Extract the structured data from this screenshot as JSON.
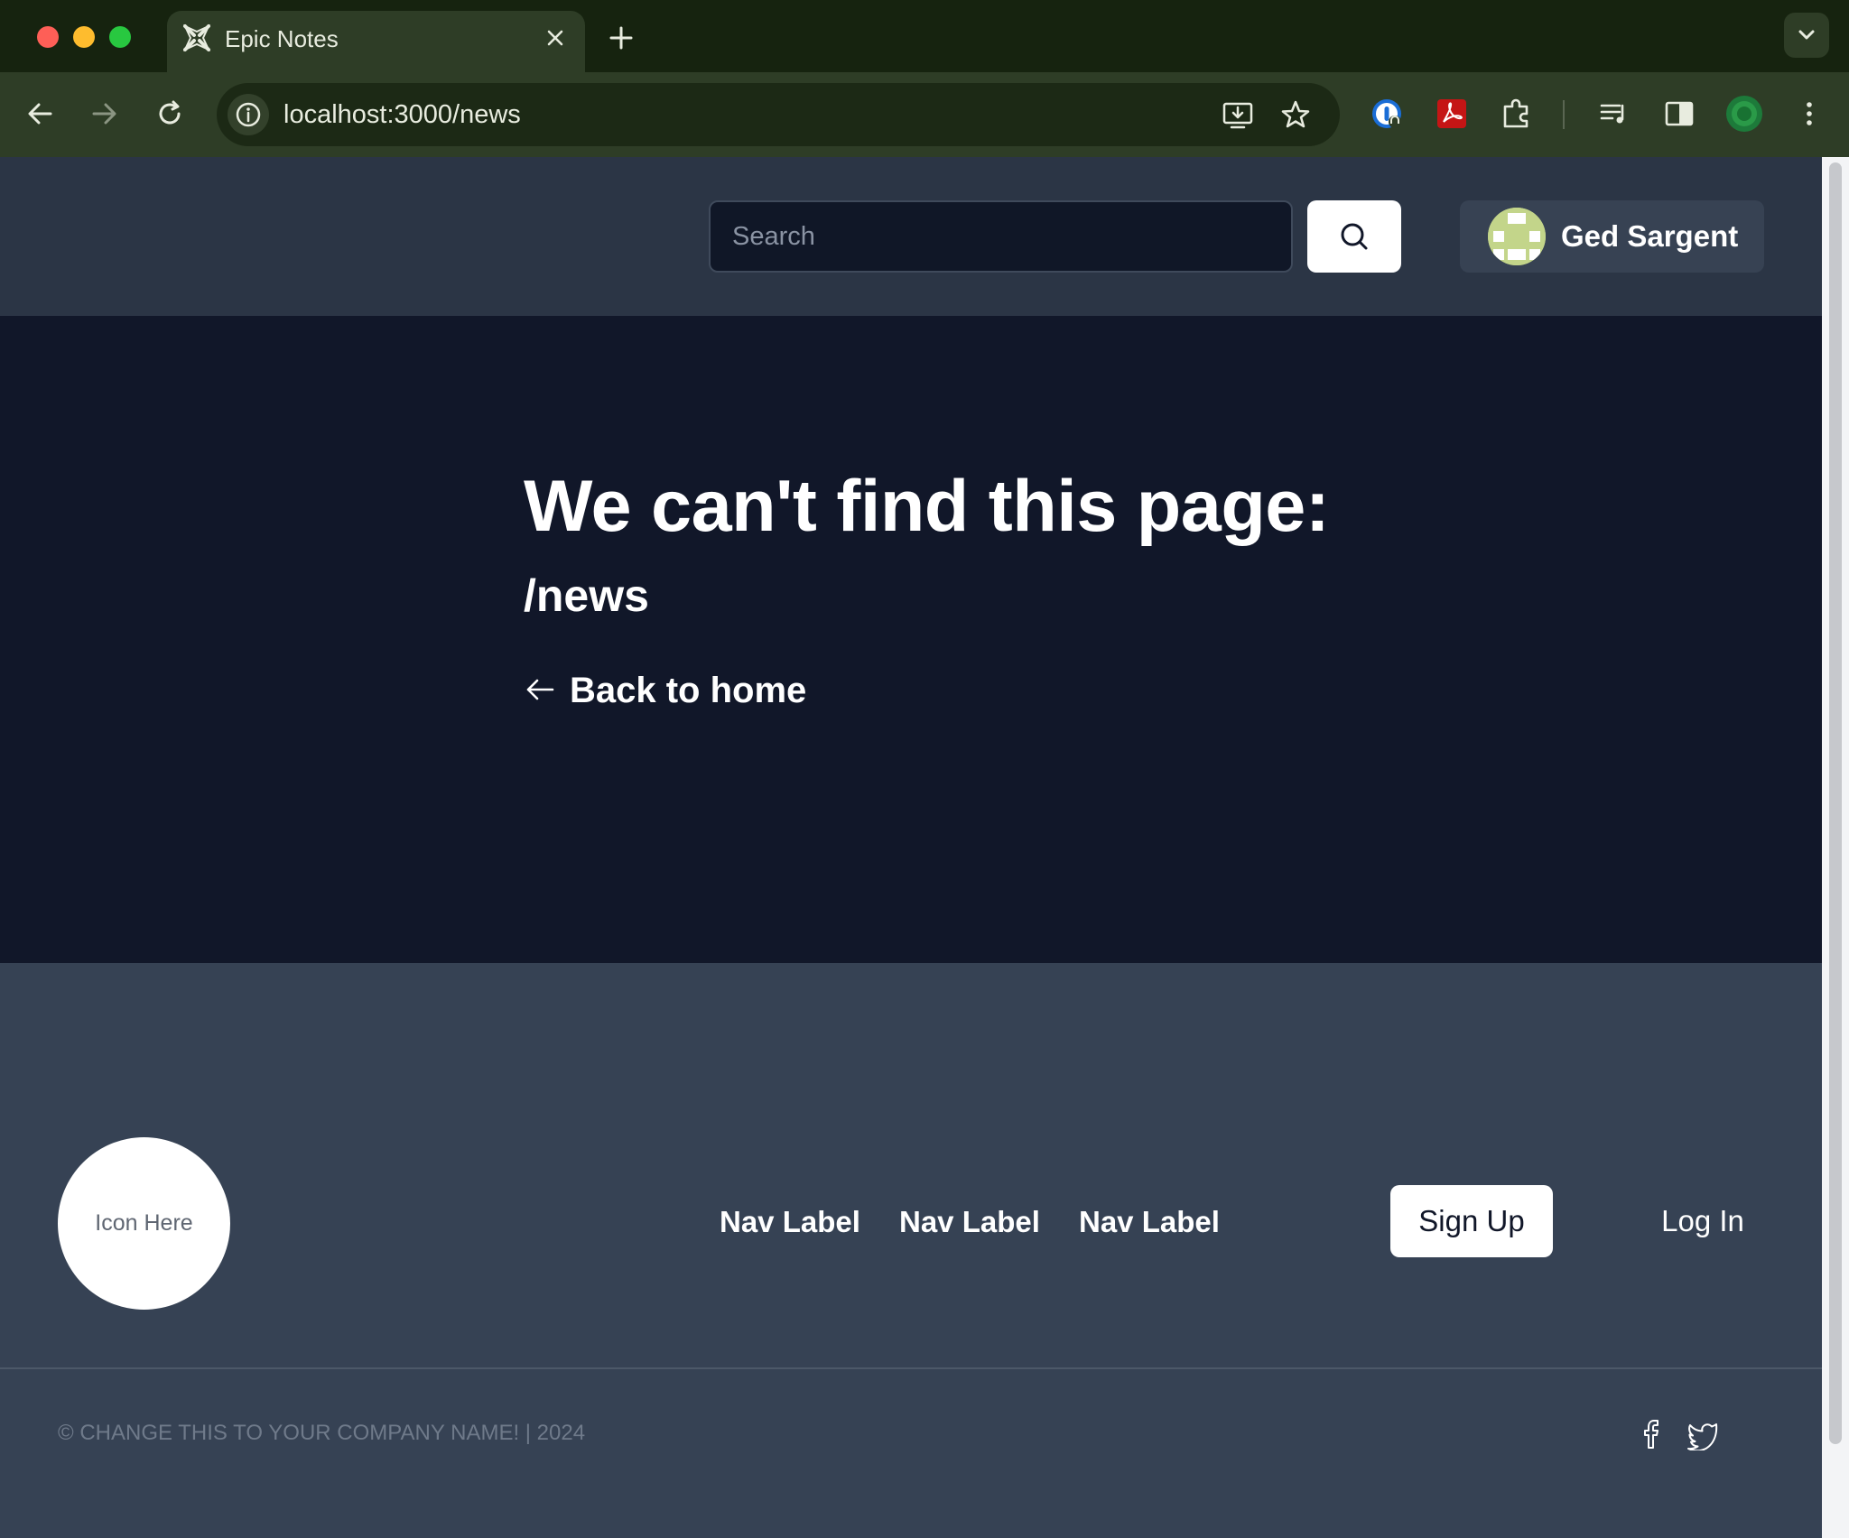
{
  "browser": {
    "tab_title": "Epic Notes",
    "url": "localhost:3000/news"
  },
  "header": {
    "search_placeholder": "Search",
    "user_name": "Ged Sargent"
  },
  "main": {
    "heading": "We can't find this page:",
    "path": "/news",
    "back_link": "Back to home"
  },
  "footer": {
    "logo_text": "Icon Here",
    "nav_labels": [
      "Nav Label",
      "Nav Label",
      "Nav Label"
    ],
    "signup_label": "Sign Up",
    "login_label": "Log In",
    "copyright": "© CHANGE THIS TO YOUR COMPANY NAME! | 2024"
  }
}
